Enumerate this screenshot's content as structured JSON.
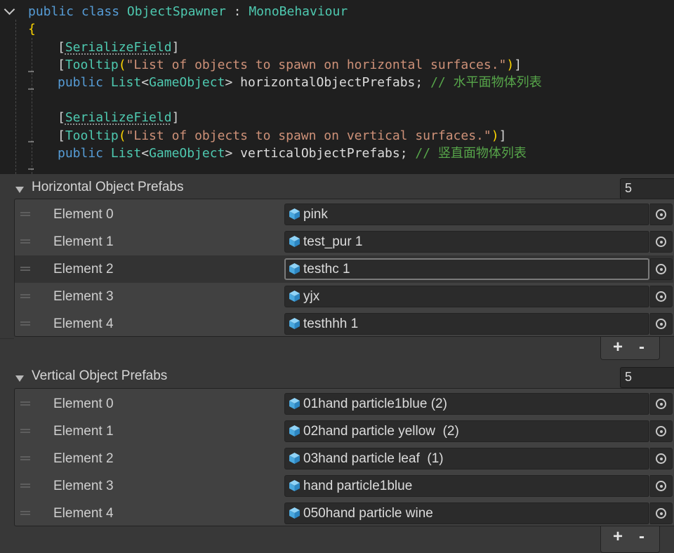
{
  "code": {
    "line_class": {
      "kw_public": "public",
      "kw_class": "class",
      "class_name": "ObjectSpawner",
      "colon": " : ",
      "base_class": "MonoBehaviour"
    },
    "brace_open": "{",
    "attr_serialize": "SerializeField",
    "tooltip_1": {
      "attr": "Tooltip",
      "text": "\"List of objects to spawn on horizontal surfaces.\""
    },
    "field_1": {
      "kw": "public",
      "type_list": "List",
      "type_arg": "GameObject",
      "name": "horizontalObjectPrefabs",
      "comment": "// 水平面物体列表"
    },
    "tooltip_2": {
      "attr": "Tooltip",
      "text": "\"List of objects to spawn on vertical surfaces.\""
    },
    "field_2": {
      "kw": "public",
      "type_list": "List",
      "type_arg": "GameObject",
      "name": "verticalObjectPrefabs",
      "comment": "// 竖直面物体列表"
    }
  },
  "inspector": {
    "horizontal": {
      "title": "Horizontal Object Prefabs",
      "count": "5",
      "items": [
        {
          "label": "Element 0",
          "value": "pink"
        },
        {
          "label": "Element 1",
          "value": "test_pur 1"
        },
        {
          "label": "Element 2",
          "value": "testhc 1"
        },
        {
          "label": "Element 3",
          "value": "yjx"
        },
        {
          "label": "Element 4",
          "value": "testhhh 1"
        }
      ],
      "add": "+",
      "remove": "-"
    },
    "vertical": {
      "title": "Vertical Object Prefabs",
      "count": "5",
      "items": [
        {
          "label": "Element 0",
          "value": "01hand particle1blue (2)"
        },
        {
          "label": "Element 1",
          "value": "02hand particle yellow  (2)"
        },
        {
          "label": "Element 2",
          "value": "03hand particle leaf  (1)"
        },
        {
          "label": "Element 3",
          "value": "hand particle1blue"
        },
        {
          "label": "Element 4",
          "value": "050hand particle wine"
        }
      ],
      "add": "+",
      "remove": "-"
    }
  },
  "colors": {
    "keyword": "#569cd6",
    "type": "#4ec9b0",
    "string": "#ce9178",
    "comment": "#57a64a",
    "brace": "#ffd700",
    "editor_bg": "#1f1f1f",
    "inspector_bg": "#383838",
    "prefab_icon": "#5bb6e8"
  },
  "icons": {
    "fold": "chevron-down-icon",
    "prefab": "prefab-cube-icon",
    "picker": "object-picker-icon",
    "drag": "drag-handle-icon",
    "foldout": "foldout-triangle-icon"
  }
}
